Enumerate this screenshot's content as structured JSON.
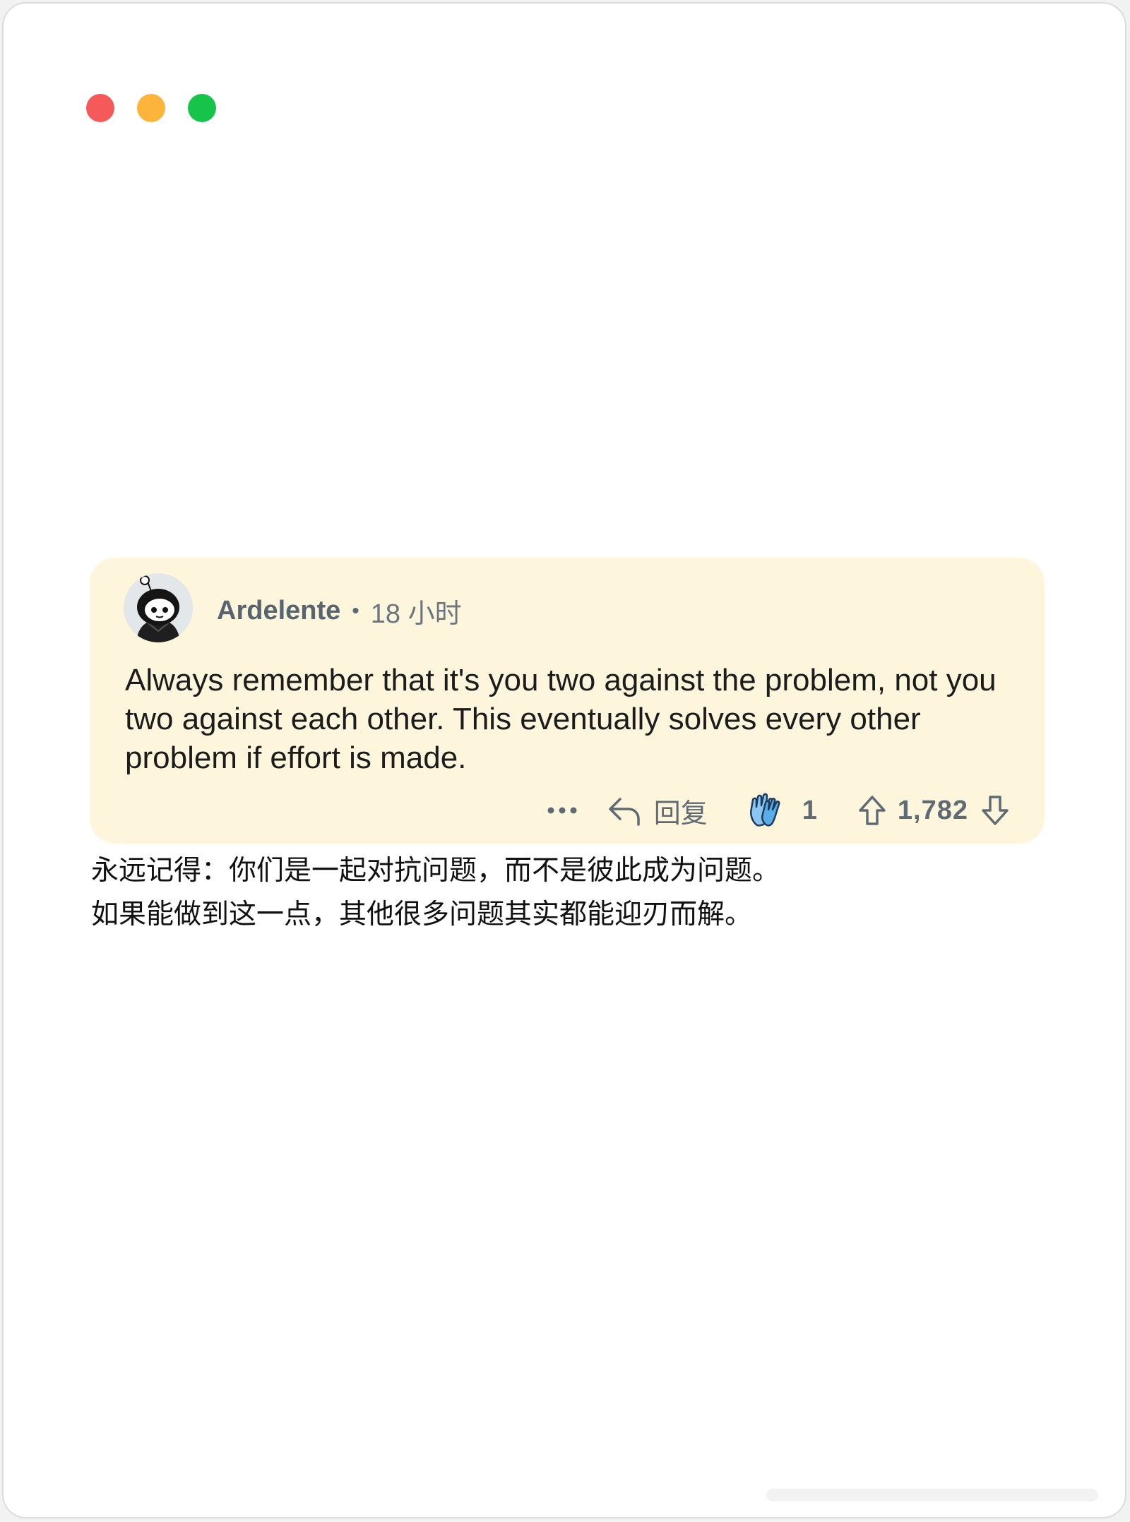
{
  "window": {
    "controls": [
      "close",
      "minimize",
      "zoom"
    ],
    "colors": {
      "close": "#f6595a",
      "minimize": "#fdb43b",
      "zoom": "#17c44a"
    }
  },
  "comment": {
    "author": "Ardelente",
    "separator": "•",
    "time": "18 小时",
    "avatar_icon": "reddit-snoo-avatar",
    "text": "Always remember that it's you two against the problem, not you two against each other. This eventually solves every other problem if effort is made.",
    "background": "#fdf6dc",
    "actions": {
      "more_icon": "ellipsis-icon",
      "reply_label": "回复",
      "award_count": "1",
      "vote_score": "1,782"
    }
  },
  "translation": {
    "line1": "永远记得：你们是一起对抗问题，而不是彼此成为问题。",
    "line2": "如果能做到这一点，其他很多问题其实都能迎刃而解。"
  }
}
